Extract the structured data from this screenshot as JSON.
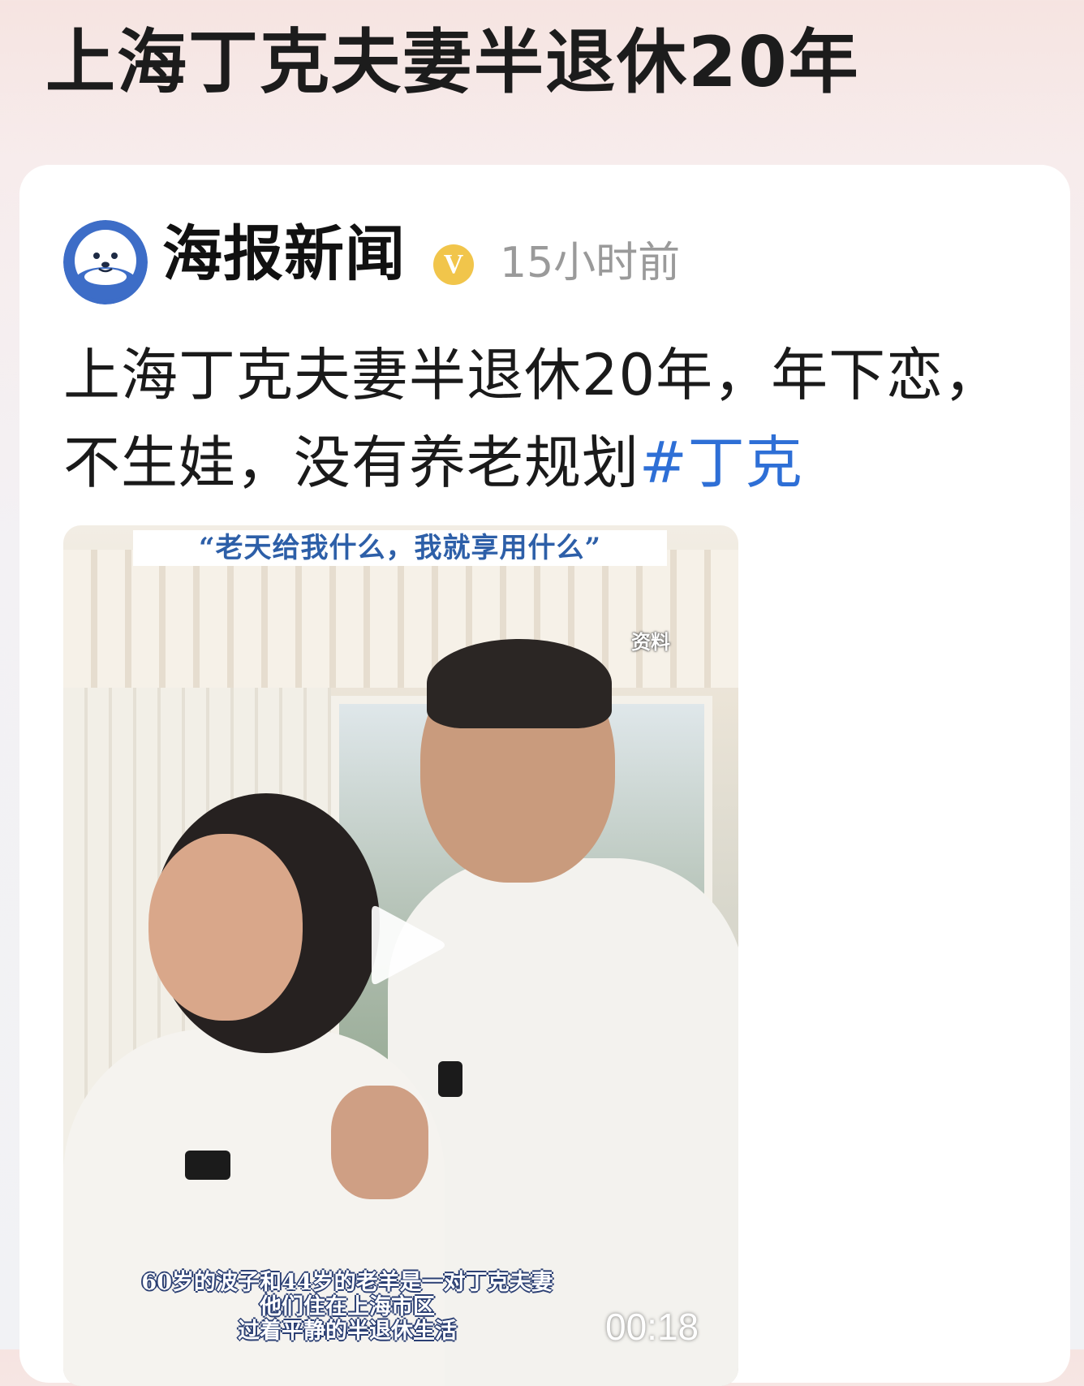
{
  "page": {
    "title": "上海丁克夫妻半退休20年"
  },
  "post": {
    "account_name": "海报新闻",
    "verified_badge": "V",
    "time": "15小时前",
    "text": "上海丁克夫妻半退休20年，年下恋，不生娃，没有养老规划",
    "hashtag": "#丁克"
  },
  "video": {
    "top_caption": "“老天给我什么，我就享用什么”",
    "source_label": "资料",
    "subtitles": [
      "60岁的波子和44岁的老羊是一对丁克夫妻",
      "他们住在上海市区",
      "过着平静的半退休生活"
    ],
    "duration": "00:18",
    "play_icon": "play-icon"
  },
  "colors": {
    "hashtag": "#2e6fd6",
    "verified": "#f1c54b",
    "avatar_blue": "#3d6dc7"
  }
}
